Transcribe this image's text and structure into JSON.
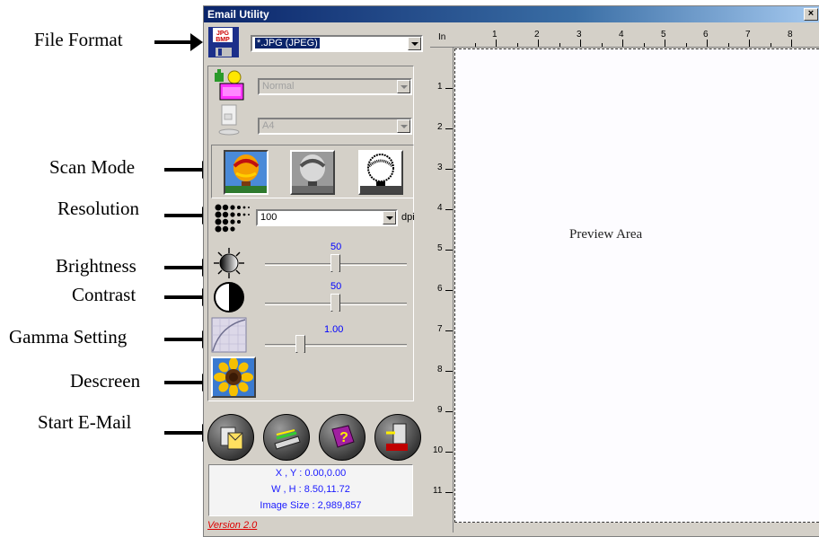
{
  "callouts": {
    "file_format": "File Format",
    "scan_mode": "Scan Mode",
    "resolution": "Resolution",
    "brightness": "Brightness",
    "contrast": "Contrast",
    "gamma": "Gamma Setting",
    "descreen": "Descreen",
    "start_email": "Start E-Mail"
  },
  "window": {
    "title": "Email Utility",
    "close_label": "×"
  },
  "file_format": {
    "value": "*.JPG (JPEG)"
  },
  "scan_type": {
    "value": "Normal"
  },
  "paper_size": {
    "value": "A4"
  },
  "resolution": {
    "value": "100",
    "unit": "dpi"
  },
  "brightness": {
    "value": "50",
    "level": 0.5
  },
  "contrast": {
    "value": "50",
    "level": 0.5
  },
  "gamma": {
    "value": "1.00",
    "level": 0.2
  },
  "info": {
    "xy": "X , Y : 0.00,0.00",
    "wh": "W , H : 8.50,11.72",
    "image_size": "Image Size : 2,989,857"
  },
  "version": "Version 2.0",
  "ruler": {
    "unit": "In",
    "h_labels": [
      "1",
      "2",
      "3",
      "4",
      "5",
      "6",
      "7",
      "8"
    ],
    "v_labels": [
      "1",
      "2",
      "3",
      "4",
      "5",
      "6",
      "7",
      "8",
      "9",
      "10",
      "11"
    ]
  },
  "preview_label": "Preview Area",
  "icons": {
    "file_format": "jpg-bmp-floppy-icon",
    "scan_type": "scanner-type-icon",
    "paper": "paper-icon",
    "resolution": "dot-grid-icon",
    "brightness": "sun-icon",
    "contrast": "contrast-icon",
    "gamma": "gamma-curve-icon",
    "descreen": "sunflower-icon",
    "start": "email-send-icon",
    "preview": "preview-scanner-icon",
    "help": "help-book-icon",
    "exit": "exit-door-icon"
  }
}
